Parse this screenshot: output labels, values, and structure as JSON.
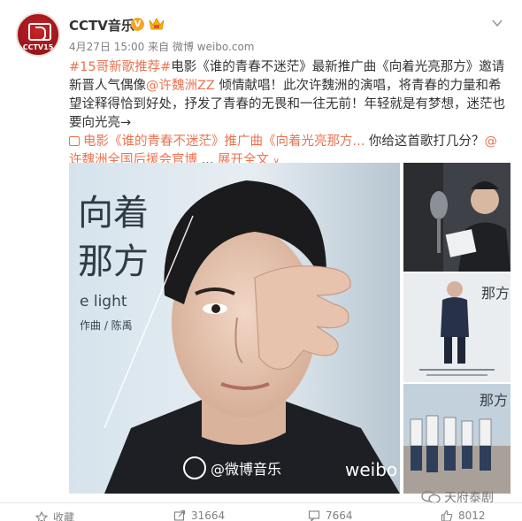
{
  "header": {
    "avatar_text": "CCTV15",
    "username": "CCTV音乐",
    "verified_symbol": "V",
    "date": "4月27日 15:00",
    "source": "来自 微博 weibo.com"
  },
  "post": {
    "tag": "#15哥新歌推荐#",
    "text1": "电影《谁的青春不迷茫》最新推广曲《向着光亮那方》邀请新晋人气偶像",
    "mention": "@许魏洲ZZ",
    "text2": " 倾情献唱！此次许魏洲的演唱，将青春的力量和希望诠释得恰到好处，抒发了青春的无畏和一往无前！年轻就是有梦想，迷茫也要向光亮→",
    "link": "电影《谁的青春不迷茫》推广曲《向着光亮那方...",
    "text3": " 你给这首歌打几分？",
    "mention2": "@许魏洲全国后援会官博",
    "ellipsis": " ... ",
    "expand": "展开全文",
    "expand_arrow": "∨"
  },
  "main_image": {
    "title_line1": "向着",
    "title_line2": "那方",
    "subtitle": "e light",
    "credit": "作曲 / 陈禹",
    "watermark_weibo": "@微博音乐",
    "watermark_brand": "weibo"
  },
  "thumbs": {
    "t2_title": "那方",
    "t3_title": "那方"
  },
  "actions": {
    "favorite": "收藏",
    "share": "31664",
    "comment": "7664",
    "like": "8012"
  },
  "watermark": {
    "text": "天府泰剧"
  },
  "colors": {
    "accent": "#eb7350",
    "meta": "#808080"
  }
}
